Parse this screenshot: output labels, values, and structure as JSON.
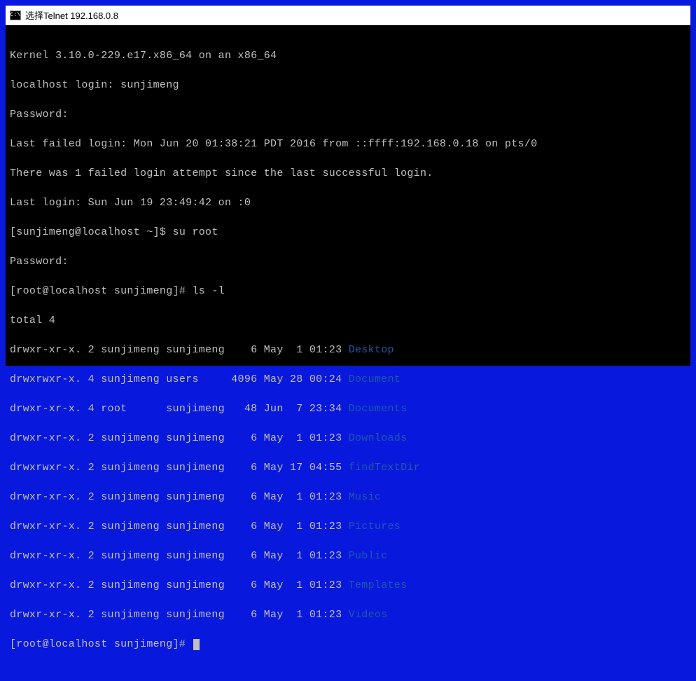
{
  "titlebar": {
    "icon_label": "C:\\",
    "title": "选择Telnet 192.168.0.8"
  },
  "lines": {
    "kernel": "Kernel 3.10.0-229.e17.x86_64 on an x86_64",
    "login": "localhost login: sunjimeng",
    "password1": "Password:",
    "lastfail": "Last failed login: Mon Jun 20 01:38:21 PDT 2016 from ::ffff:192.168.0.18 on pts/0",
    "failattempt": "There was 1 failed login attempt since the last successful login.",
    "lastlogin": "Last login: Sun Jun 19 23:49:42 on :0",
    "prompt_user": "[sunjimeng@localhost ~]$ su root",
    "password2": "Password:",
    "prompt_root_ls": "[root@localhost sunjimeng]# ls -l",
    "total": "total 4",
    "prompt_root_end": "[root@localhost sunjimeng]# "
  },
  "listing": [
    {
      "meta": "drwxr-xr-x. 2 sunjimeng sunjimeng    6 May  1 01:23 ",
      "name": "Desktop"
    },
    {
      "meta": "drwxrwxr-x. 4 sunjimeng users     4096 May 28 00:24 ",
      "name": "Document"
    },
    {
      "meta": "drwxr-xr-x. 4 root      sunjimeng   48 Jun  7 23:34 ",
      "name": "Documents"
    },
    {
      "meta": "drwxr-xr-x. 2 sunjimeng sunjimeng    6 May  1 01:23 ",
      "name": "Downloads"
    },
    {
      "meta": "drwxrwxr-x. 2 sunjimeng sunjimeng    6 May 17 04:55 ",
      "name": "findTextDir"
    },
    {
      "meta": "drwxr-xr-x. 2 sunjimeng sunjimeng    6 May  1 01:23 ",
      "name": "Music"
    },
    {
      "meta": "drwxr-xr-x. 2 sunjimeng sunjimeng    6 May  1 01:23 ",
      "name": "Pictures"
    },
    {
      "meta": "drwxr-xr-x. 2 sunjimeng sunjimeng    6 May  1 01:23 ",
      "name": "Public"
    },
    {
      "meta": "drwxr-xr-x. 2 sunjimeng sunjimeng    6 May  1 01:23 ",
      "name": "Templates"
    },
    {
      "meta": "drwxr-xr-x. 2 sunjimeng sunjimeng    6 May  1 01:23 ",
      "name": "Videos"
    }
  ]
}
